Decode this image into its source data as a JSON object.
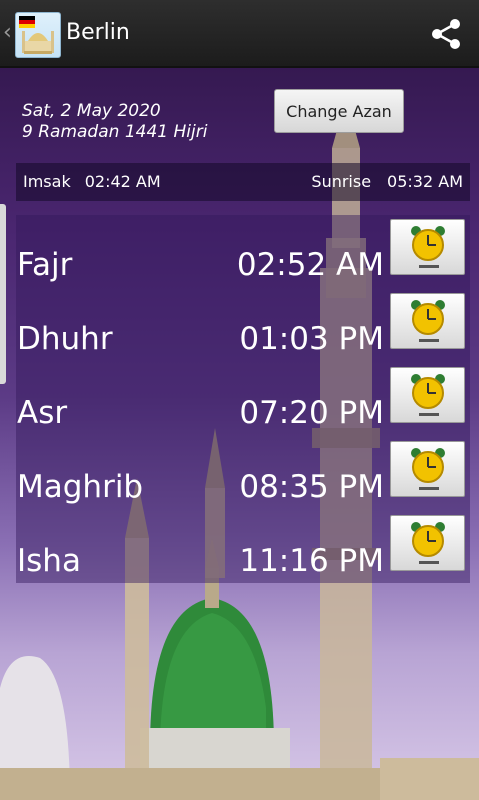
{
  "action_bar": {
    "title": "Berlin",
    "flag_colors": [
      "#000000",
      "#dd0000",
      "#ffce00"
    ],
    "app_icon": "mosque-icon",
    "share_icon": "share-icon"
  },
  "header": {
    "gregorian_date": "Sat, 2 May 2020",
    "hijri_date": "9 Ramadan 1441 Hijri",
    "change_azan_label": "Change Azan"
  },
  "info_bar": {
    "imsak_label": "Imsak",
    "imsak_time": "02:42 AM",
    "sunrise_label": "Sunrise",
    "sunrise_time": "05:32 AM"
  },
  "prayers": [
    {
      "name": "Fajr",
      "time": "02:52 AM",
      "alarm_icon": "alarm-clock-icon"
    },
    {
      "name": "Dhuhr",
      "time": "01:03 PM",
      "alarm_icon": "alarm-clock-icon"
    },
    {
      "name": "Asr",
      "time": "07:20 PM",
      "alarm_icon": "alarm-clock-icon"
    },
    {
      "name": "Maghrib",
      "time": "08:35 PM",
      "alarm_icon": "alarm-clock-icon"
    },
    {
      "name": "Isha",
      "time": "11:16 PM",
      "alarm_icon": "alarm-clock-icon"
    }
  ],
  "colors": {
    "accent_text": "#ffffff",
    "background_purple": "#4a2670",
    "dome_green": "#2f8a3a",
    "alarm_yellow": "#f2c200"
  }
}
